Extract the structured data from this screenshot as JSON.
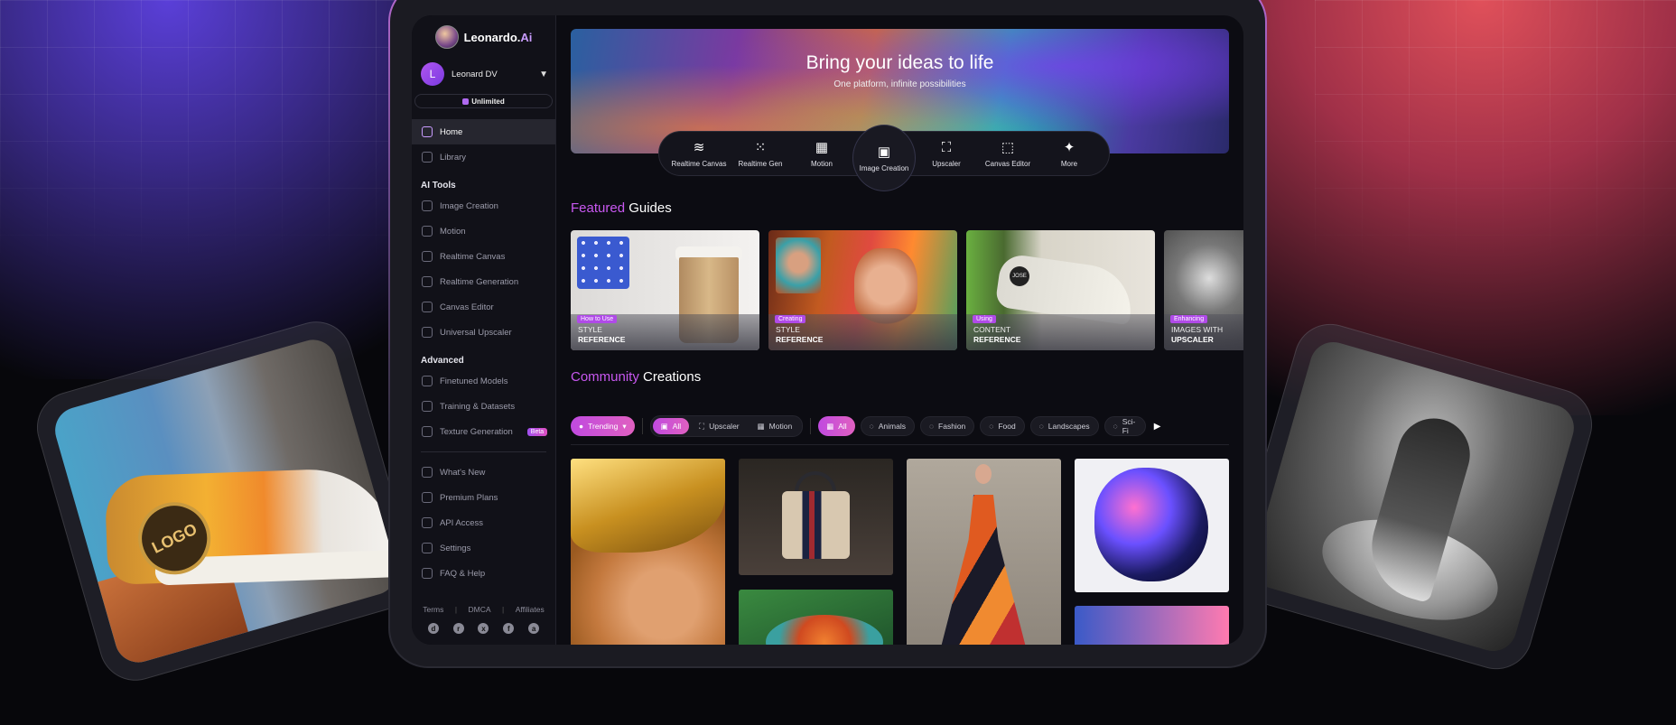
{
  "app": {
    "brand_name": "Leonardo.",
    "brand_suffix": "Ai",
    "user": {
      "initial": "L",
      "name": "Leonard DV"
    },
    "plan_badge": "Unlimited"
  },
  "sidebar": {
    "primary": [
      {
        "label": "Home",
        "icon": "home-icon",
        "active": true
      },
      {
        "label": "Library",
        "icon": "grid-icon",
        "active": false
      }
    ],
    "ai_tools_heading": "AI Tools",
    "ai_tools": [
      {
        "label": "Image Creation",
        "icon": "image-icon"
      },
      {
        "label": "Motion",
        "icon": "film-icon"
      },
      {
        "label": "Realtime Canvas",
        "icon": "brush-icon"
      },
      {
        "label": "Realtime Generation",
        "icon": "dots-grid-icon"
      },
      {
        "label": "Canvas Editor",
        "icon": "crop-icon"
      },
      {
        "label": "Universal Upscaler",
        "icon": "upscale-icon"
      }
    ],
    "advanced_heading": "Advanced",
    "advanced": [
      {
        "label": "Finetuned Models",
        "icon": "cube-icon"
      },
      {
        "label": "Training & Datasets",
        "icon": "dataset-icon"
      },
      {
        "label": "Texture Generation",
        "icon": "texture-icon",
        "badge": "Beta"
      }
    ],
    "secondary": [
      {
        "label": "What's New",
        "icon": "megaphone-icon"
      },
      {
        "label": "Premium Plans",
        "icon": "crown-icon"
      },
      {
        "label": "API Access",
        "icon": "key-icon"
      },
      {
        "label": "Settings",
        "icon": "gear-icon"
      },
      {
        "label": "FAQ & Help",
        "icon": "help-icon"
      }
    ],
    "footer_links": [
      "Terms",
      "DMCA",
      "Affiliates"
    ],
    "socials": [
      "discord-icon",
      "reddit-icon",
      "x-icon",
      "facebook-icon",
      "apple-icon"
    ]
  },
  "hero": {
    "title": "Bring your ideas to life",
    "subtitle": "One platform, infinite possibilities",
    "tools": [
      {
        "label": "Realtime Canvas",
        "icon": "brush-icon",
        "glyph": "≋"
      },
      {
        "label": "Realtime Gen",
        "icon": "dots-grid-icon",
        "glyph": "⁙"
      },
      {
        "label": "Motion",
        "icon": "film-icon",
        "glyph": "▦"
      },
      {
        "label": "Image Creation",
        "icon": "image-icon",
        "glyph": "▣",
        "selected": true
      },
      {
        "label": "Upscaler",
        "icon": "upscale-icon",
        "glyph": "⛶"
      },
      {
        "label": "Canvas Editor",
        "icon": "crop-icon",
        "glyph": "⬚"
      },
      {
        "label": "More",
        "icon": "sparkle-icon",
        "glyph": "✦"
      }
    ]
  },
  "featured": {
    "title_highlight": "Featured",
    "title_rest": "Guides",
    "cards": [
      {
        "tag": "How to Use",
        "line1": "STYLE",
        "line2": "REFERENCE"
      },
      {
        "tag": "Creating",
        "line1": "STYLE",
        "line2": "REFERENCE"
      },
      {
        "tag": "Using",
        "line1": "CONTENT",
        "line2": "REFERENCE",
        "shoe_badge": "JOSE"
      },
      {
        "tag": "Enhancing",
        "line1": "IMAGES WITH",
        "line2": "UPSCALER"
      }
    ]
  },
  "community": {
    "title_highlight": "Community",
    "title_rest": "Creations",
    "sort": "Trending",
    "type_filters": [
      "All",
      "Upscaler",
      "Motion"
    ],
    "category_filters": [
      "All",
      "Animals",
      "Fashion",
      "Food",
      "Landscapes",
      "Sci-Fi"
    ]
  },
  "showcase": {
    "left_card_logo": "LOGO"
  },
  "colors": {
    "accent": "#c858f0",
    "brand_ai": "#c99cff",
    "background": "#0c0c12"
  }
}
